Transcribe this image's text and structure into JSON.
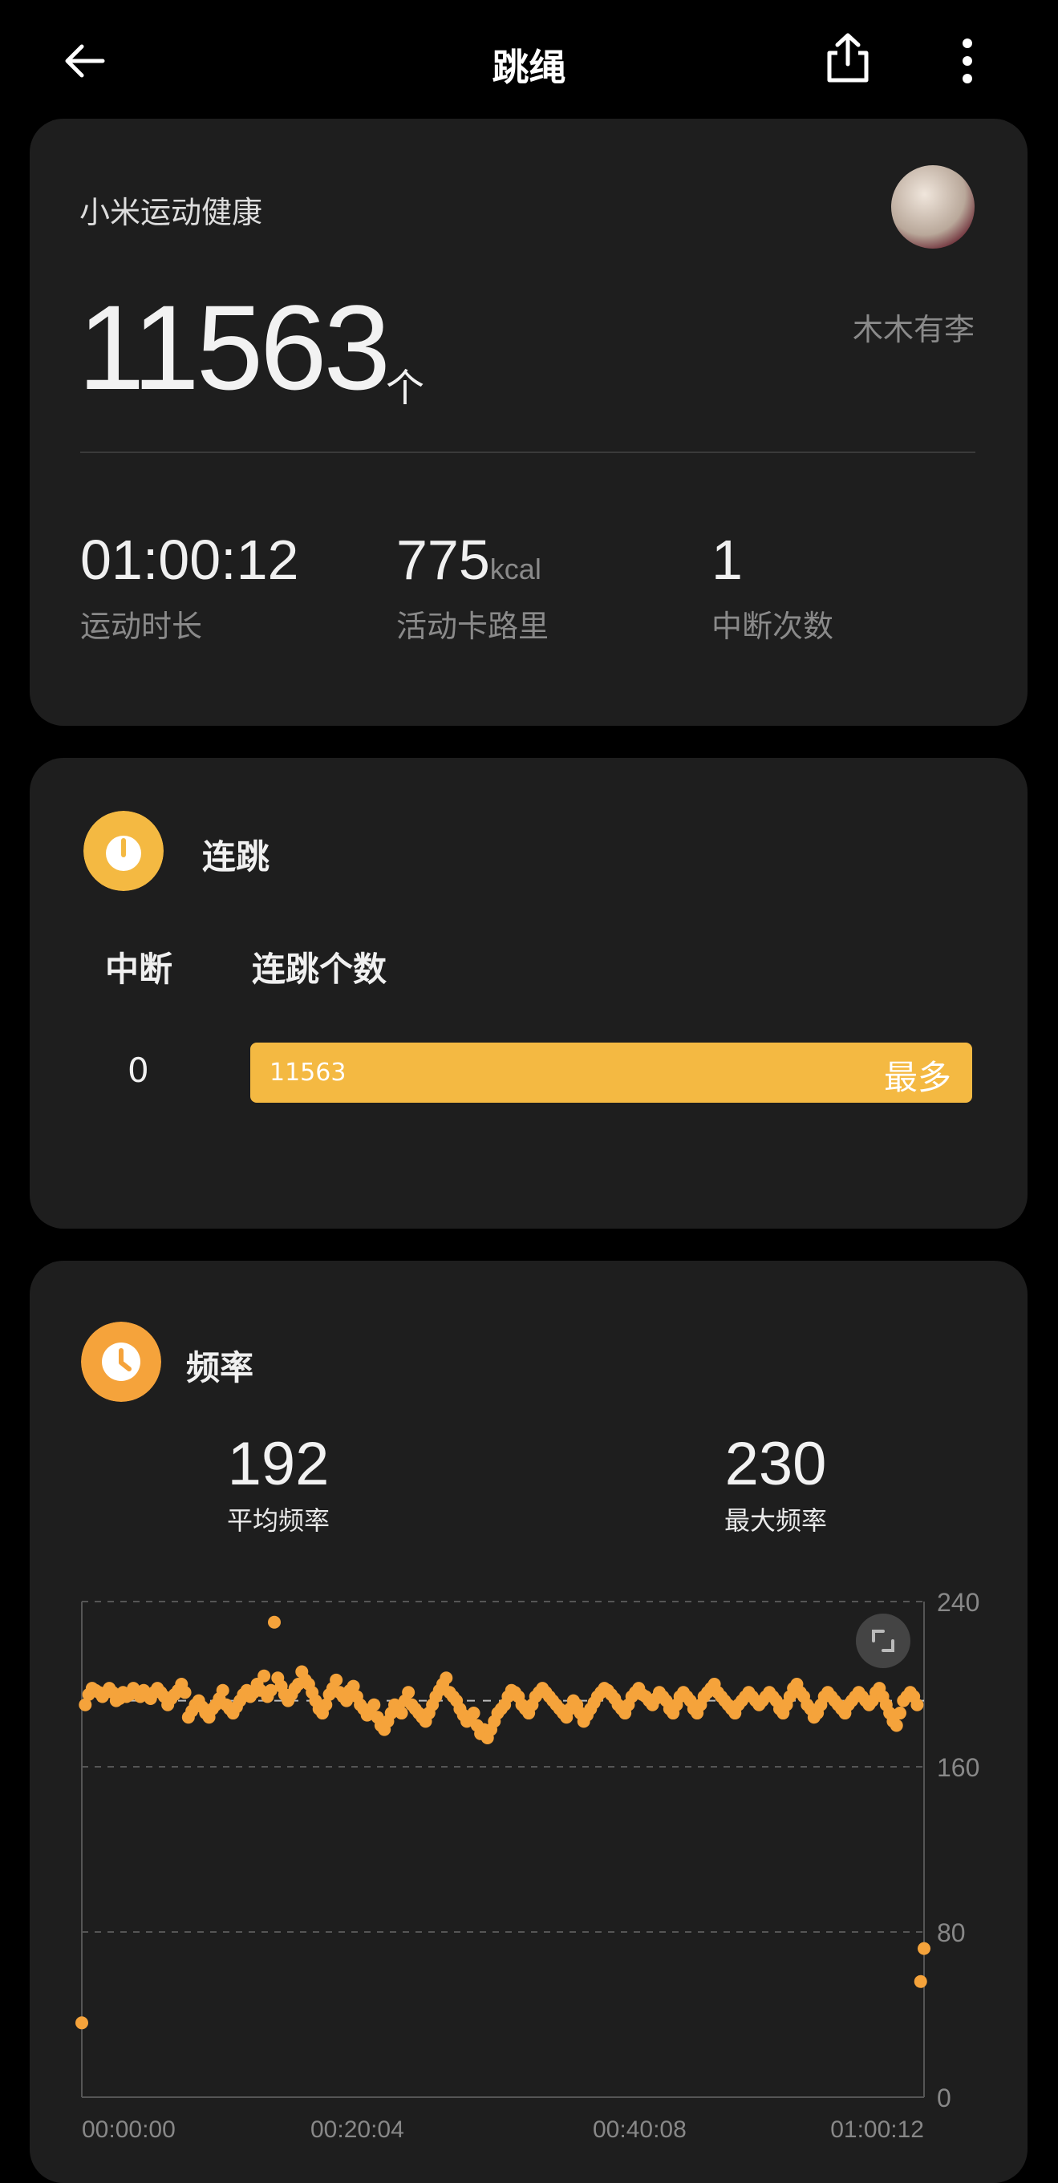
{
  "header": {
    "title": "跳绳"
  },
  "summary": {
    "brand": "小米运动健康",
    "count": "11563",
    "count_unit": "个",
    "username": "木木有李",
    "stats": [
      {
        "value": "01:00:12",
        "unit": "",
        "label": "运动时长"
      },
      {
        "value": "775",
        "unit": "kcal",
        "label": "活动卡路里"
      },
      {
        "value": "1",
        "unit": "",
        "label": "中断次数"
      }
    ]
  },
  "consecutive": {
    "title": "连跳",
    "col_interrupt": "中断",
    "col_count": "连跳个数",
    "rows": [
      {
        "interrupt": "0",
        "count": "11563",
        "tag": "最多",
        "fraction": 1.0
      }
    ],
    "accent": "#f4b942"
  },
  "frequency": {
    "title": "频率",
    "avg_value": "192",
    "avg_label": "平均频率",
    "max_value": "230",
    "max_label": "最大频率",
    "accent": "#f5a33b"
  },
  "chart_data": {
    "type": "scatter",
    "x_ticks": [
      "00:00:00",
      "00:20:04",
      "00:40:08",
      "01:00:12"
    ],
    "y_ticks": [
      "240",
      "160",
      "80",
      "0"
    ],
    "ylim": [
      0,
      240
    ],
    "xlim_seconds": [
      0,
      3612
    ],
    "avg_line": 192,
    "grid": true,
    "series": [
      {
        "values": [
          36,
          190,
          195,
          198,
          197,
          196,
          194,
          196,
          198,
          196,
          192,
          193,
          196,
          194,
          195,
          198,
          196,
          194,
          197,
          195,
          193,
          196,
          198,
          196,
          194,
          190,
          193,
          195,
          197,
          200,
          196,
          184,
          187,
          190,
          192,
          189,
          186,
          184,
          188,
          190,
          193,
          197,
          190,
          188,
          186,
          189,
          192,
          195,
          197,
          194,
          196,
          200,
          197,
          204,
          194,
          197,
          230,
          203,
          199,
          195,
          192,
          195,
          198,
          200,
          206,
          202,
          200,
          196,
          192,
          188,
          186,
          190,
          195,
          198,
          202,
          196,
          194,
          192,
          197,
          199,
          194,
          190,
          188,
          185,
          186,
          190,
          184,
          180,
          178,
          182,
          186,
          190,
          188,
          186,
          192,
          196,
          190,
          188,
          186,
          184,
          182,
          186,
          190,
          194,
          197,
          200,
          203,
          196,
          194,
          192,
          188,
          185,
          182,
          184,
          186,
          180,
          176,
          178,
          174,
          178,
          182,
          186,
          188,
          190,
          194,
          197,
          196,
          194,
          190,
          188,
          186,
          190,
          194,
          196,
          198,
          196,
          194,
          192,
          190,
          188,
          186,
          184,
          188,
          192,
          190,
          186,
          182,
          185,
          188,
          191,
          194,
          196,
          198,
          197,
          195,
          193,
          190,
          188,
          186,
          190,
          194,
          196,
          198,
          195,
          194,
          192,
          190,
          193,
          196,
          194,
          192,
          188,
          186,
          190,
          194,
          196,
          194,
          192,
          188,
          186,
          190,
          194,
          196,
          198,
          200,
          196,
          194,
          192,
          190,
          188,
          186,
          190,
          192,
          194,
          196,
          194,
          192,
          190,
          192,
          194,
          196,
          194,
          192,
          188,
          186,
          190,
          194,
          198,
          200,
          196,
          194,
          190,
          188,
          184,
          186,
          190,
          194,
          196,
          194,
          192,
          190,
          188,
          186,
          190,
          192,
          194,
          196,
          194,
          192,
          190,
          192,
          196,
          198,
          194,
          190,
          186,
          182,
          180,
          186,
          192,
          194,
          196,
          194,
          190,
          56,
          72
        ]
      }
    ]
  }
}
